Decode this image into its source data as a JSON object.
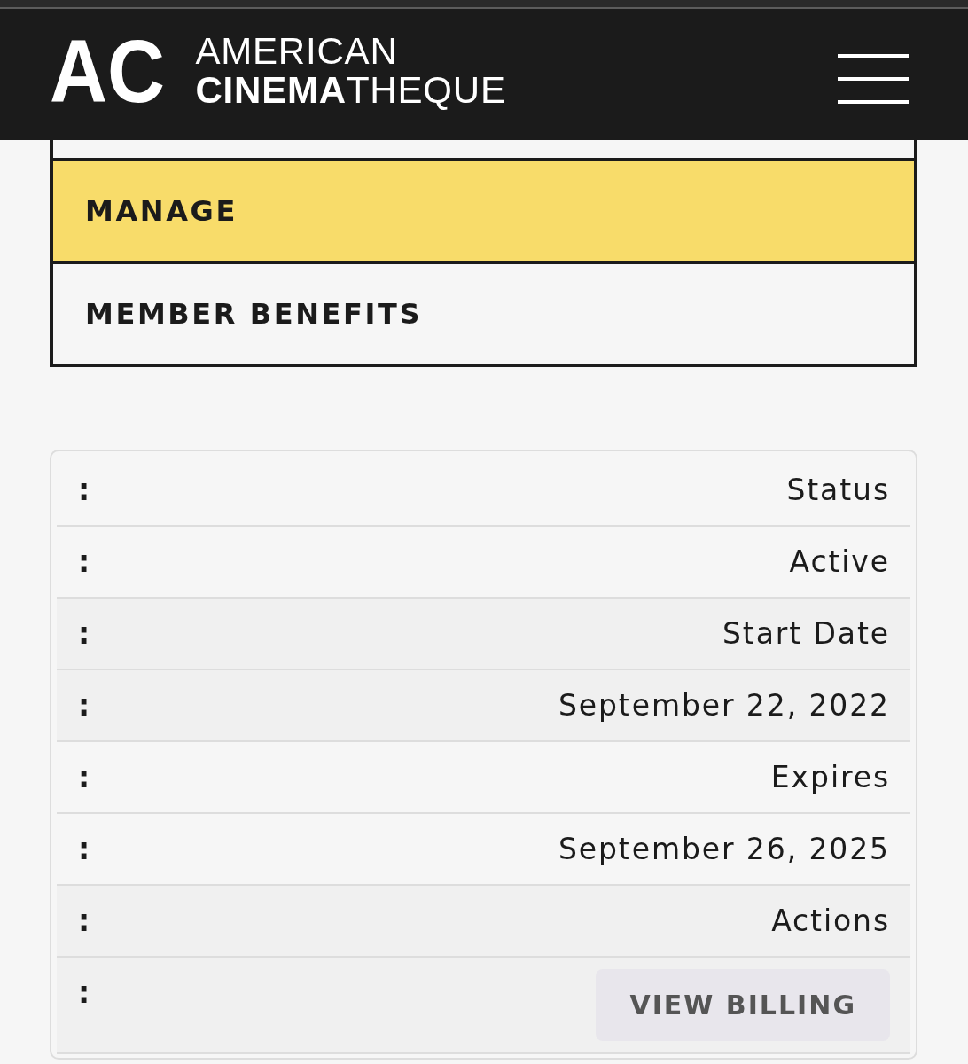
{
  "header": {
    "logo_mark": "AC",
    "brand_lines": [
      "AMERICAN",
      "**CINEMA**THEQUE"
    ]
  },
  "nav_menu": {
    "items": [
      {
        "label": "MANAGE",
        "selected": true
      },
      {
        "label": "MEMBER BENEFITS",
        "selected": false
      }
    ]
  },
  "table": {
    "rows": [
      {
        "cells": [
          {
            "kind": "text",
            "prefix": ":",
            "text": "Status"
          },
          {
            "kind": "text",
            "prefix": ":",
            "text": "Active"
          }
        ]
      },
      {
        "cells": [
          {
            "kind": "text",
            "prefix": ":",
            "text": "Start Date"
          },
          {
            "kind": "text",
            "prefix": ":",
            "text": "September 22, 2022"
          }
        ]
      },
      {
        "cells": [
          {
            "kind": "text",
            "prefix": ":",
            "text": "Expires"
          },
          {
            "kind": "text",
            "prefix": ":",
            "text": "September 26, 2025"
          }
        ]
      },
      {
        "cells": [
          {
            "kind": "text",
            "prefix": ":",
            "text": "Actions"
          },
          {
            "kind": "button",
            "prefix": ":",
            "text": "VIEW BILLING"
          }
        ]
      }
    ]
  }
}
